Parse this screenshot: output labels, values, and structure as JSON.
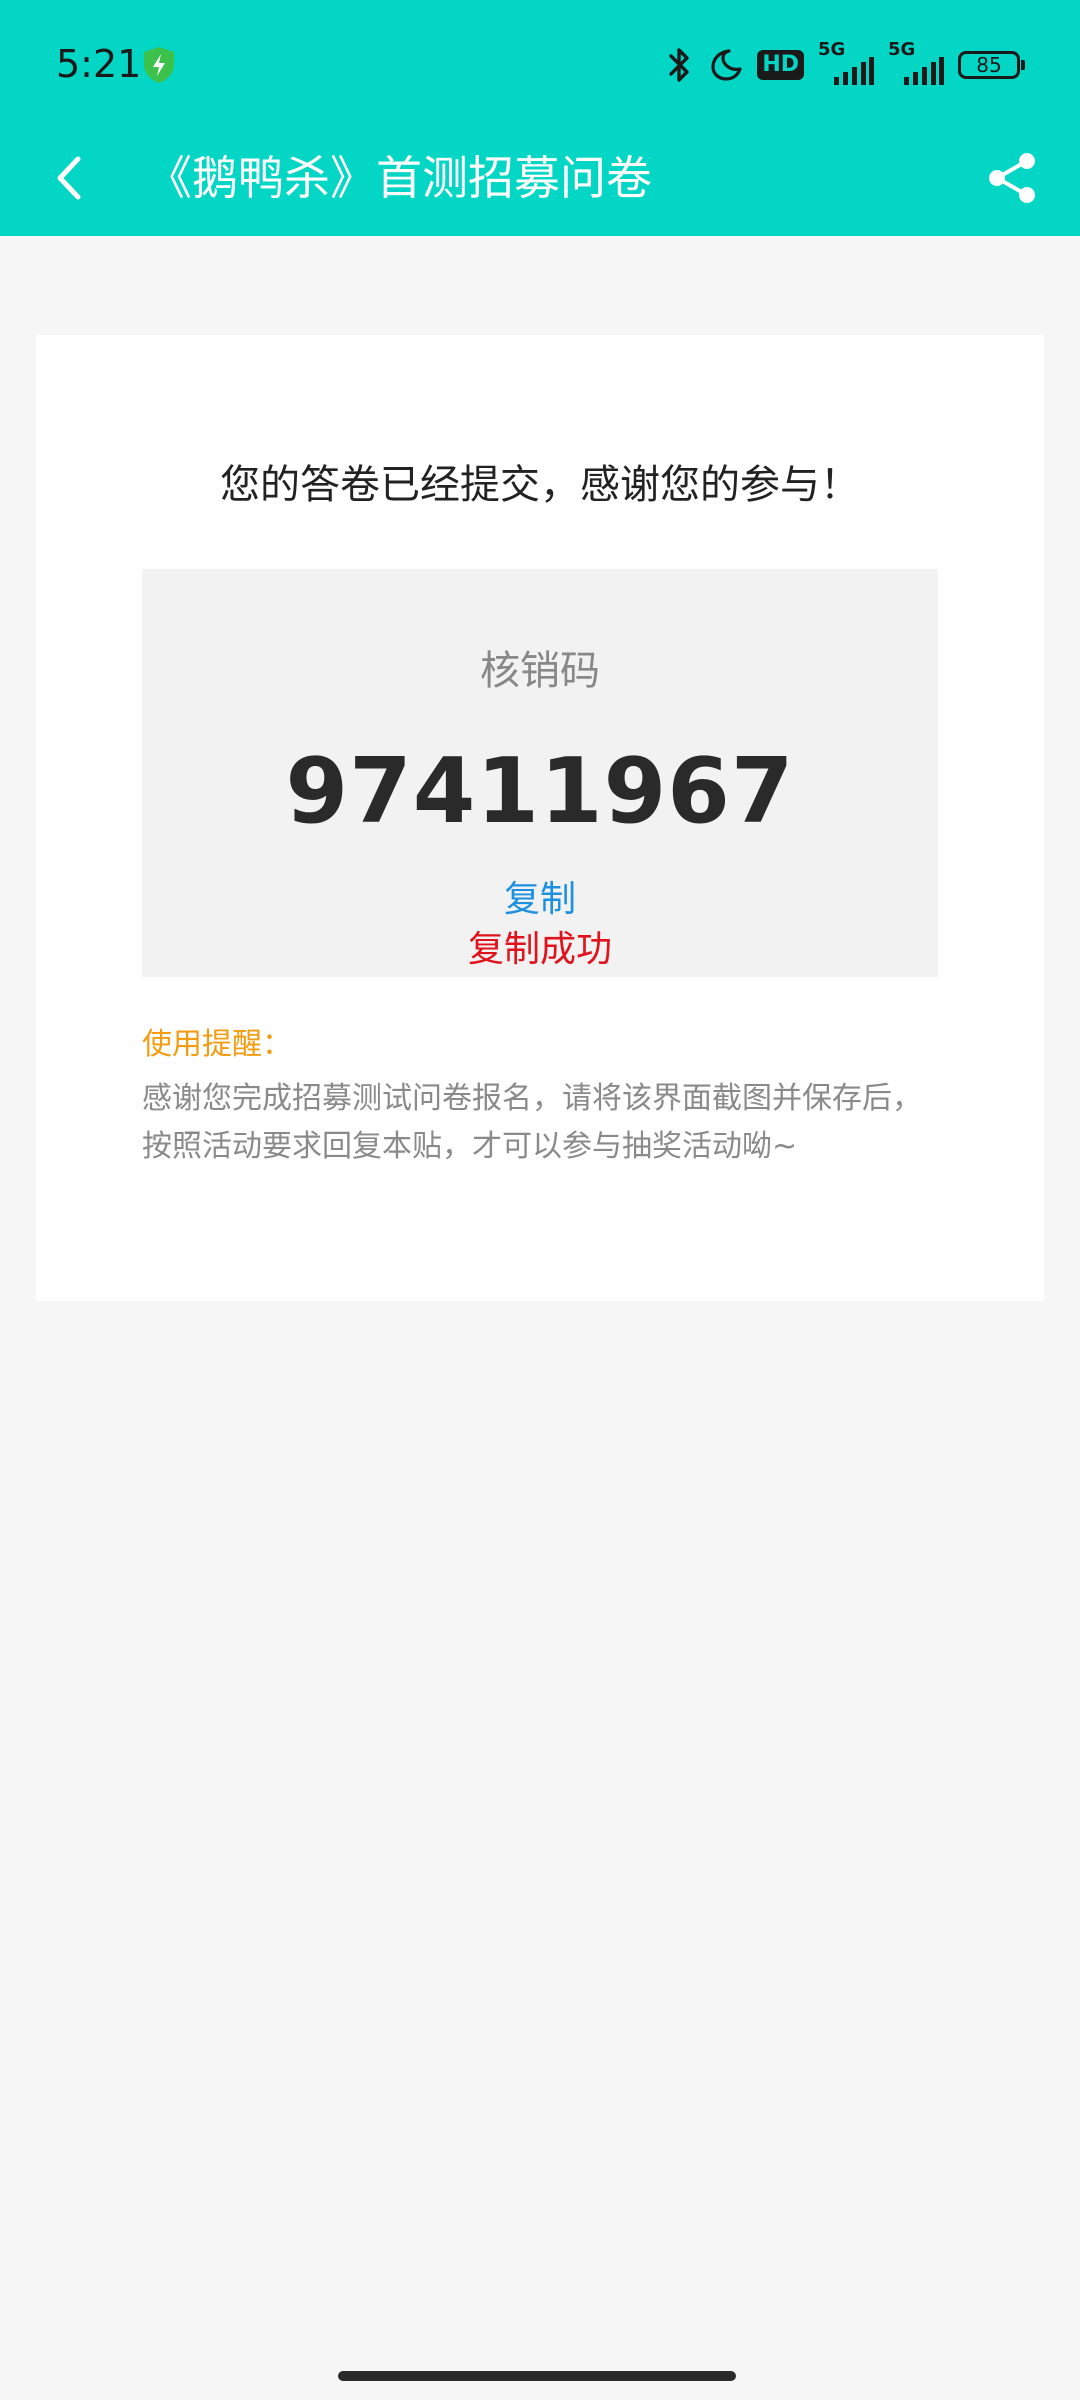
{
  "status_bar": {
    "time": "5:21",
    "hd_label": "HD",
    "sim1_label": "5G",
    "sim2_label": "5G",
    "battery": "85"
  },
  "header": {
    "title": "《鹅鸭杀》首测招募问卷"
  },
  "card": {
    "thanks": "您的答卷已经提交，感谢您的参与！",
    "code_label": "核销码",
    "code_value": "97411967",
    "copy_label": "复制",
    "copy_status": "复制成功",
    "reminder_title": "使用提醒：",
    "reminder_text": "感谢您完成招募测试问卷报名，请将该界面截图并保存后，按照活动要求回复本贴，才可以参与抽奖活动呦~"
  },
  "colors": {
    "accent": "#04d6c5",
    "link": "#1e90e0",
    "success": "#e0121b",
    "reminder": "#f39c12"
  }
}
